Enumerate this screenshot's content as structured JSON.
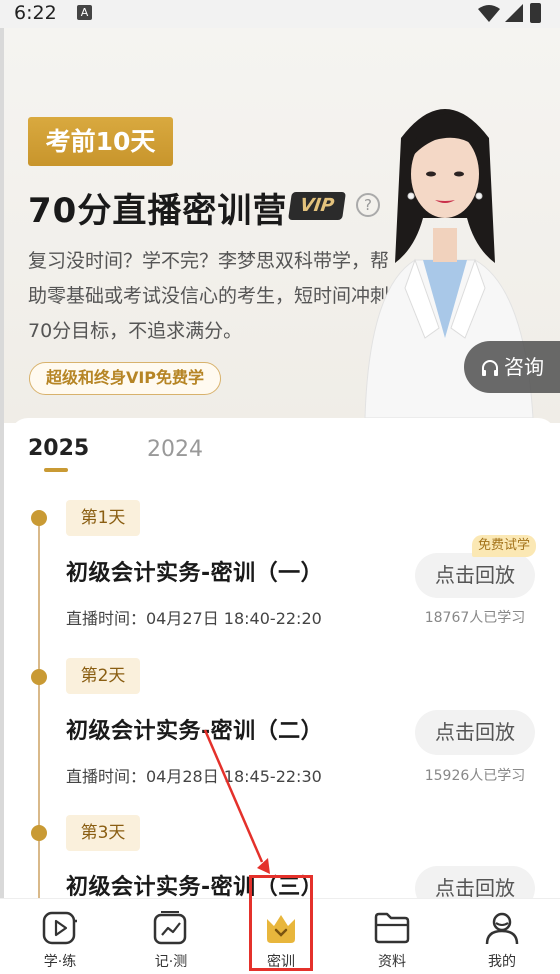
{
  "status_bar": {
    "time": "6:22",
    "notification_glyph": "A"
  },
  "hero": {
    "badge": "考前10天",
    "title": "70分直播密训营",
    "vip_tag": "VIP",
    "help_glyph": "?",
    "description": "复习没时间？学不完？李梦思双科带学，帮助零基础或考试没信心的考生，短时间冲刺70分目标，不追求满分。",
    "vip_free_label": "超级和终身VIP免费学",
    "consult_label": "咨询"
  },
  "tabs": {
    "active": "2025",
    "inactive": "2024"
  },
  "courses": [
    {
      "day": "第1天",
      "title": "初级会计实务-密训（一）",
      "live_time": "直播时间：04月27日 18:40-22:20",
      "button": "点击回放",
      "learners": "18767人已学习",
      "tag": "免费试学"
    },
    {
      "day": "第2天",
      "title": "初级会计实务-密训（二）",
      "live_time": "直播时间：04月28日 18:45-22:30",
      "button": "点击回放",
      "learners": "15926人已学习"
    },
    {
      "day": "第3天",
      "title": "初级会计实务-密训（三）",
      "button": "点击回放"
    }
  ],
  "nav": [
    {
      "label": "学·练",
      "icon": "play-icon"
    },
    {
      "label": "记·测",
      "icon": "chart-icon"
    },
    {
      "label": "密训",
      "icon": "crown-icon"
    },
    {
      "label": "资料",
      "icon": "folder-icon"
    },
    {
      "label": "我的",
      "icon": "user-icon"
    }
  ],
  "colors": {
    "accent": "#c99a34",
    "annotation": "#e4312b"
  }
}
